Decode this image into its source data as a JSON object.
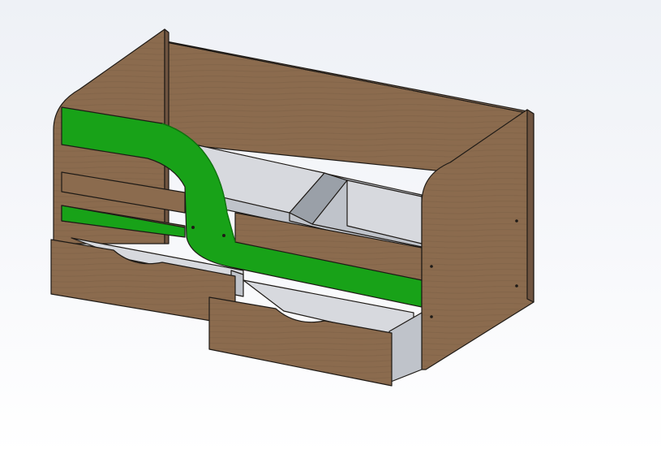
{
  "scene": {
    "subject": "bed-with-drawers",
    "colors": {
      "background_top": "#eef1f6",
      "background_mid": "#f7f8fb",
      "background_bottom": "#ffffff",
      "wood_main": "#8b6b4e",
      "wood_dark": "#6f5440",
      "wood_light": "#a3846a",
      "wood_edge": "#5a4333",
      "rail_green": "#18a218",
      "rail_green_dark": "#0d7a0d",
      "interior_light": "#d7d9de",
      "interior_mid": "#bfc3ca",
      "interior_dark": "#9aa0a8",
      "outline": "#1e1a16"
    }
  }
}
